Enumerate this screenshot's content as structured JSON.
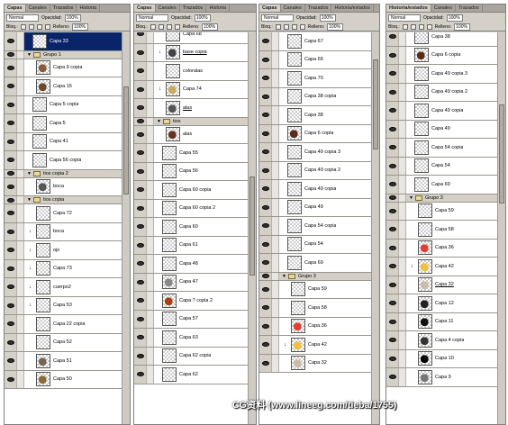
{
  "tabs": {
    "p1": [
      "Capas",
      "Canales",
      "Trazados",
      "Historia"
    ],
    "p2": [
      "Capas",
      "Canales",
      "Trazados",
      "Historia"
    ],
    "p3": [
      "Capas",
      "Canales",
      "Trazados",
      "Historia/estados"
    ],
    "p4": [
      "Historia/estados",
      "Canales",
      "Trazados"
    ]
  },
  "opts": {
    "mode": "Normal",
    "mode_p4": "Normal",
    "opacity_label": "Opacidad:",
    "opacity": "100%",
    "lock_label": "Bloq.:",
    "fill_label": "Relleno:",
    "fill": "100%"
  },
  "panel1": {
    "rows": [
      {
        "t": "layer",
        "n": "Capa 33",
        "sel": true
      },
      {
        "t": "group",
        "n": "Grupo 1"
      },
      {
        "t": "layer",
        "n": "Capa 9 copia",
        "sub": true,
        "img": "#8a5a3a"
      },
      {
        "t": "layer",
        "n": "Capa 16",
        "sub": true,
        "img": "#6a4a2a"
      },
      {
        "t": "layer",
        "n": "Capa 5 copia"
      },
      {
        "t": "layer",
        "n": "Capa 5"
      },
      {
        "t": "layer",
        "n": "Capa 41"
      },
      {
        "t": "layer",
        "n": "Capa 56 copia"
      },
      {
        "t": "group",
        "n": "tios copia 2"
      },
      {
        "t": "layer",
        "n": "boca",
        "sub": true,
        "img": "#555"
      },
      {
        "t": "group",
        "n": "tios copia"
      },
      {
        "t": "layer",
        "n": "Capa 72",
        "sub": true
      },
      {
        "t": "layer",
        "n": "boca",
        "sub": true,
        "fx": true
      },
      {
        "t": "layer",
        "n": "ojo",
        "sub": true,
        "fx": true
      },
      {
        "t": "layer",
        "n": "Capa 73",
        "sub": true,
        "fx": true
      },
      {
        "t": "layer",
        "n": "cuerpo2",
        "sub": true,
        "fx": true
      },
      {
        "t": "layer",
        "n": "Capa 53",
        "sub": true,
        "fx": true
      },
      {
        "t": "layer",
        "n": "Capa 22 copia",
        "sub": true
      },
      {
        "t": "layer",
        "n": "Capa 52",
        "sub": true
      },
      {
        "t": "layer",
        "n": "Capa 51",
        "sub": true,
        "img": "#776655"
      },
      {
        "t": "layer",
        "n": "Capa 50",
        "sub": true,
        "img": "#8a6a3a"
      }
    ]
  },
  "panel2": {
    "rows": [
      {
        "t": "layer",
        "n": "Capa 68",
        "sub": true
      },
      {
        "t": "layer",
        "n": "base copia",
        "sub": true,
        "fx": true,
        "u": true,
        "img": "#444"
      },
      {
        "t": "layer",
        "n": "coloralas",
        "sub": true
      },
      {
        "t": "layer",
        "n": "Capa 74",
        "sub": true,
        "fx": true,
        "img": "#caa860"
      },
      {
        "t": "layer",
        "n": "alas",
        "sub": true,
        "u": true,
        "img": "#555"
      },
      {
        "t": "group",
        "n": "tios"
      },
      {
        "t": "layer",
        "n": "alas",
        "sub": true,
        "img": "#663322"
      },
      {
        "t": "layer",
        "n": "Capa 55"
      },
      {
        "t": "layer",
        "n": "Capa 56"
      },
      {
        "t": "layer",
        "n": "Capa 60 copia"
      },
      {
        "t": "layer",
        "n": "Capa 60 copia 2"
      },
      {
        "t": "layer",
        "n": "Capa 60"
      },
      {
        "t": "layer",
        "n": "Capa 61"
      },
      {
        "t": "layer",
        "n": "Capa 48"
      },
      {
        "t": "layer",
        "n": "Capa 47",
        "img": "#888"
      },
      {
        "t": "layer",
        "n": "Capa 7 copia 2",
        "img": "#b04010"
      },
      {
        "t": "layer",
        "n": "Capa 57"
      },
      {
        "t": "layer",
        "n": "Capa 63"
      },
      {
        "t": "layer",
        "n": "Capa 62 copia"
      },
      {
        "t": "layer",
        "n": "Capa 62"
      }
    ]
  },
  "panel3": {
    "rows": [
      {
        "t": "layer",
        "n": "Capa 67"
      },
      {
        "t": "layer",
        "n": "Capa 66"
      },
      {
        "t": "layer",
        "n": "Capa 70"
      },
      {
        "t": "layer",
        "n": "Capa 38 copia"
      },
      {
        "t": "layer",
        "n": "Capa 38"
      },
      {
        "t": "layer",
        "n": "Capa 6 copia",
        "img": "#5a2a1a"
      },
      {
        "t": "layer",
        "n": "Capa 49 copia 3"
      },
      {
        "t": "layer",
        "n": "Capa 49 copia 2"
      },
      {
        "t": "layer",
        "n": "Capa 49 copia"
      },
      {
        "t": "layer",
        "n": "Capa 49"
      },
      {
        "t": "layer",
        "n": "Capa 54 copia"
      },
      {
        "t": "layer",
        "n": "Capa 54"
      },
      {
        "t": "layer",
        "n": "Capa 69"
      },
      {
        "t": "group",
        "n": "Grupo 3"
      },
      {
        "t": "layer",
        "n": "Capa 59",
        "sub": true
      },
      {
        "t": "layer",
        "n": "Capa 58",
        "sub": true
      },
      {
        "t": "layer",
        "n": "Capa 36",
        "sub": true,
        "img": "#e04030"
      },
      {
        "t": "layer",
        "n": "Capa 42",
        "sub": true,
        "fx": true,
        "img": "#f0c040"
      },
      {
        "t": "layer",
        "n": "Capa 32",
        "sub": true,
        "img": "#ccbbaa"
      }
    ]
  },
  "panel4": {
    "rows": [
      {
        "t": "layer",
        "n": "Capa 38"
      },
      {
        "t": "layer",
        "n": "Capa 6 copia",
        "img": "#5a2a1a"
      },
      {
        "t": "layer",
        "n": "Capa 49 copia 3"
      },
      {
        "t": "layer",
        "n": "Capa 49 copia 2"
      },
      {
        "t": "layer",
        "n": "Capa 49 copia"
      },
      {
        "t": "layer",
        "n": "Capa 49"
      },
      {
        "t": "layer",
        "n": "Capa 54 copia"
      },
      {
        "t": "layer",
        "n": "Capa 54"
      },
      {
        "t": "layer",
        "n": "Capa 69"
      },
      {
        "t": "group",
        "n": "Grupo 3"
      },
      {
        "t": "layer",
        "n": "Capa 59",
        "sub": true
      },
      {
        "t": "layer",
        "n": "Capa 58",
        "sub": true
      },
      {
        "t": "layer",
        "n": "Capa 36",
        "sub": true,
        "img": "#e04030"
      },
      {
        "t": "layer",
        "n": "Capa 42",
        "sub": true,
        "fx": true,
        "img": "#f0c040"
      },
      {
        "t": "layer",
        "n": "Capa 32",
        "sub": true,
        "u": true,
        "img": "#ccbbaa"
      },
      {
        "t": "layer",
        "n": "Capa 12",
        "sub": true,
        "img": "#222"
      },
      {
        "t": "layer",
        "n": "Capa 11",
        "sub": true,
        "img": "#111"
      },
      {
        "t": "layer",
        "n": "Capa 4 copia",
        "sub": true,
        "img": "#333"
      },
      {
        "t": "layer",
        "n": "Capa 10",
        "sub": true,
        "img": "#000"
      },
      {
        "t": "layer",
        "n": "Capa 9",
        "sub": true,
        "img": "#777"
      }
    ]
  },
  "watermark": "CG资料 (www.lineeg.com/tieba/1755)"
}
